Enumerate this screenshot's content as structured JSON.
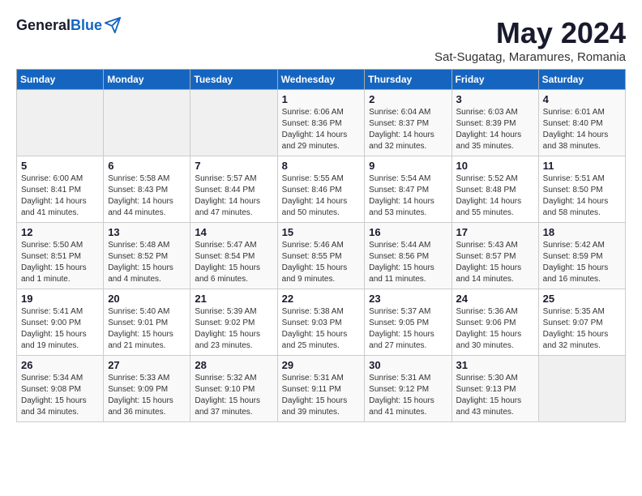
{
  "logo": {
    "general": "General",
    "blue": "Blue"
  },
  "title": "May 2024",
  "location": "Sat-Sugatag, Maramures, Romania",
  "days_of_week": [
    "Sunday",
    "Monday",
    "Tuesday",
    "Wednesday",
    "Thursday",
    "Friday",
    "Saturday"
  ],
  "weeks": [
    [
      {
        "day": "",
        "info": ""
      },
      {
        "day": "",
        "info": ""
      },
      {
        "day": "",
        "info": ""
      },
      {
        "day": "1",
        "info": "Sunrise: 6:06 AM\nSunset: 8:36 PM\nDaylight: 14 hours\nand 29 minutes."
      },
      {
        "day": "2",
        "info": "Sunrise: 6:04 AM\nSunset: 8:37 PM\nDaylight: 14 hours\nand 32 minutes."
      },
      {
        "day": "3",
        "info": "Sunrise: 6:03 AM\nSunset: 8:39 PM\nDaylight: 14 hours\nand 35 minutes."
      },
      {
        "day": "4",
        "info": "Sunrise: 6:01 AM\nSunset: 8:40 PM\nDaylight: 14 hours\nand 38 minutes."
      }
    ],
    [
      {
        "day": "5",
        "info": "Sunrise: 6:00 AM\nSunset: 8:41 PM\nDaylight: 14 hours\nand 41 minutes."
      },
      {
        "day": "6",
        "info": "Sunrise: 5:58 AM\nSunset: 8:43 PM\nDaylight: 14 hours\nand 44 minutes."
      },
      {
        "day": "7",
        "info": "Sunrise: 5:57 AM\nSunset: 8:44 PM\nDaylight: 14 hours\nand 47 minutes."
      },
      {
        "day": "8",
        "info": "Sunrise: 5:55 AM\nSunset: 8:46 PM\nDaylight: 14 hours\nand 50 minutes."
      },
      {
        "day": "9",
        "info": "Sunrise: 5:54 AM\nSunset: 8:47 PM\nDaylight: 14 hours\nand 53 minutes."
      },
      {
        "day": "10",
        "info": "Sunrise: 5:52 AM\nSunset: 8:48 PM\nDaylight: 14 hours\nand 55 minutes."
      },
      {
        "day": "11",
        "info": "Sunrise: 5:51 AM\nSunset: 8:50 PM\nDaylight: 14 hours\nand 58 minutes."
      }
    ],
    [
      {
        "day": "12",
        "info": "Sunrise: 5:50 AM\nSunset: 8:51 PM\nDaylight: 15 hours\nand 1 minute."
      },
      {
        "day": "13",
        "info": "Sunrise: 5:48 AM\nSunset: 8:52 PM\nDaylight: 15 hours\nand 4 minutes."
      },
      {
        "day": "14",
        "info": "Sunrise: 5:47 AM\nSunset: 8:54 PM\nDaylight: 15 hours\nand 6 minutes."
      },
      {
        "day": "15",
        "info": "Sunrise: 5:46 AM\nSunset: 8:55 PM\nDaylight: 15 hours\nand 9 minutes."
      },
      {
        "day": "16",
        "info": "Sunrise: 5:44 AM\nSunset: 8:56 PM\nDaylight: 15 hours\nand 11 minutes."
      },
      {
        "day": "17",
        "info": "Sunrise: 5:43 AM\nSunset: 8:57 PM\nDaylight: 15 hours\nand 14 minutes."
      },
      {
        "day": "18",
        "info": "Sunrise: 5:42 AM\nSunset: 8:59 PM\nDaylight: 15 hours\nand 16 minutes."
      }
    ],
    [
      {
        "day": "19",
        "info": "Sunrise: 5:41 AM\nSunset: 9:00 PM\nDaylight: 15 hours\nand 19 minutes."
      },
      {
        "day": "20",
        "info": "Sunrise: 5:40 AM\nSunset: 9:01 PM\nDaylight: 15 hours\nand 21 minutes."
      },
      {
        "day": "21",
        "info": "Sunrise: 5:39 AM\nSunset: 9:02 PM\nDaylight: 15 hours\nand 23 minutes."
      },
      {
        "day": "22",
        "info": "Sunrise: 5:38 AM\nSunset: 9:03 PM\nDaylight: 15 hours\nand 25 minutes."
      },
      {
        "day": "23",
        "info": "Sunrise: 5:37 AM\nSunset: 9:05 PM\nDaylight: 15 hours\nand 27 minutes."
      },
      {
        "day": "24",
        "info": "Sunrise: 5:36 AM\nSunset: 9:06 PM\nDaylight: 15 hours\nand 30 minutes."
      },
      {
        "day": "25",
        "info": "Sunrise: 5:35 AM\nSunset: 9:07 PM\nDaylight: 15 hours\nand 32 minutes."
      }
    ],
    [
      {
        "day": "26",
        "info": "Sunrise: 5:34 AM\nSunset: 9:08 PM\nDaylight: 15 hours\nand 34 minutes."
      },
      {
        "day": "27",
        "info": "Sunrise: 5:33 AM\nSunset: 9:09 PM\nDaylight: 15 hours\nand 36 minutes."
      },
      {
        "day": "28",
        "info": "Sunrise: 5:32 AM\nSunset: 9:10 PM\nDaylight: 15 hours\nand 37 minutes."
      },
      {
        "day": "29",
        "info": "Sunrise: 5:31 AM\nSunset: 9:11 PM\nDaylight: 15 hours\nand 39 minutes."
      },
      {
        "day": "30",
        "info": "Sunrise: 5:31 AM\nSunset: 9:12 PM\nDaylight: 15 hours\nand 41 minutes."
      },
      {
        "day": "31",
        "info": "Sunrise: 5:30 AM\nSunset: 9:13 PM\nDaylight: 15 hours\nand 43 minutes."
      },
      {
        "day": "",
        "info": ""
      }
    ]
  ]
}
